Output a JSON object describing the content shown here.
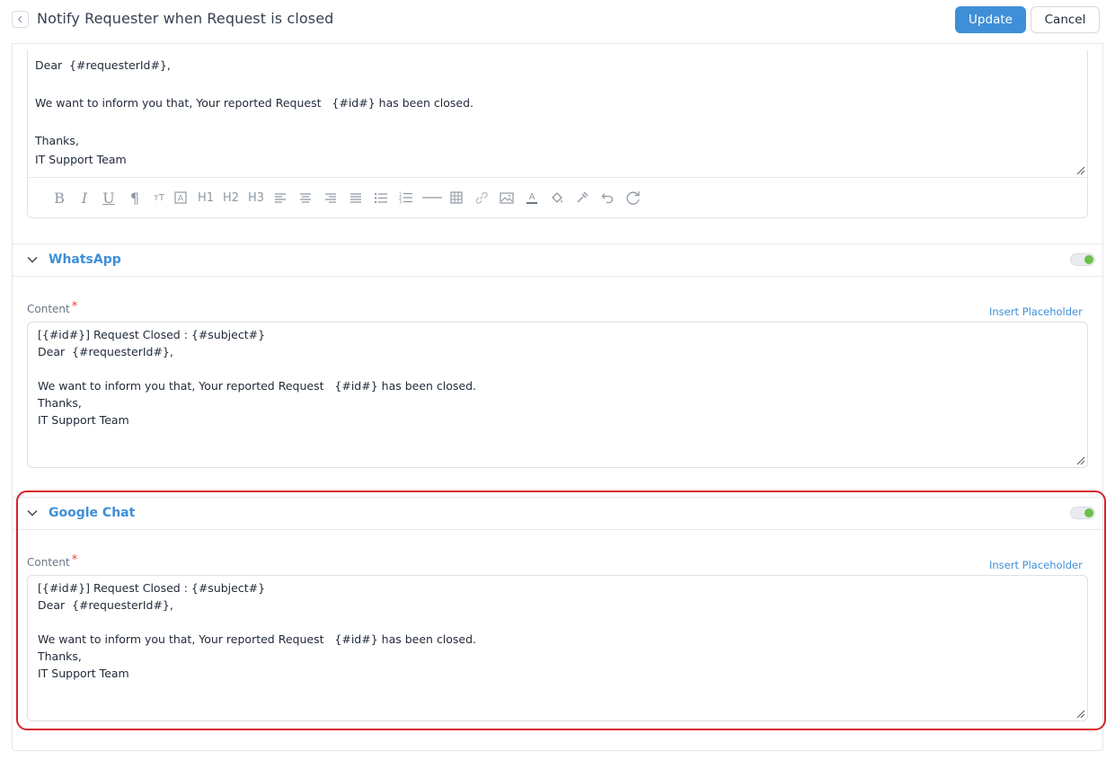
{
  "header": {
    "title": "Notify Requester when Request is closed",
    "update_label": "Update",
    "cancel_label": "Cancel"
  },
  "email": {
    "lines": [
      "Dear  {#requesterId#},",
      "",
      "We want to inform you that, Your reported Request   {#id#} has been closed.",
      "",
      "Thanks,",
      "IT Support Team"
    ],
    "toolbar": [
      "bold-icon",
      "italic-icon",
      "underline-icon",
      "paragraph-icon",
      "font-size-icon",
      "text-box-icon",
      "heading-1",
      "heading-2",
      "heading-3",
      "align-left-icon",
      "align-center-icon",
      "align-right-icon",
      "align-justify-icon",
      "bullet-list-icon",
      "numbered-list-icon",
      "horizontal-rule-icon",
      "table-icon",
      "link-icon",
      "image-icon",
      "text-color-icon",
      "fill-color-icon",
      "clear-format-icon",
      "undo-icon",
      "redo-icon"
    ],
    "toolbar_text": {
      "h1": "H1",
      "h2": "H2",
      "h3": "H3"
    }
  },
  "whatsapp": {
    "title": "WhatsApp",
    "enabled": true,
    "content_label": "Content",
    "required_mark": "*",
    "insert_placeholder": "Insert Placeholder",
    "lines": [
      "[{#id#}] Request Closed : {#subject#}",
      "Dear  {#requesterId#},",
      "",
      "We want to inform you that, Your reported Request   {#id#} has been closed.",
      "Thanks,",
      "IT Support Team"
    ]
  },
  "google_chat": {
    "title": "Google Chat",
    "enabled": true,
    "content_label": "Content",
    "required_mark": "*",
    "insert_placeholder": "Insert Placeholder",
    "lines": [
      "[{#id#}] Request Closed : {#subject#}",
      "Dear  {#requesterId#},",
      "",
      "We want to inform you that, Your reported Request   {#id#} has been closed.",
      "Thanks,",
      "IT Support Team"
    ]
  },
  "colors": {
    "accent": "#3f8fd8",
    "toggle_on": "#6cc04a",
    "highlight": "#d8212a"
  }
}
